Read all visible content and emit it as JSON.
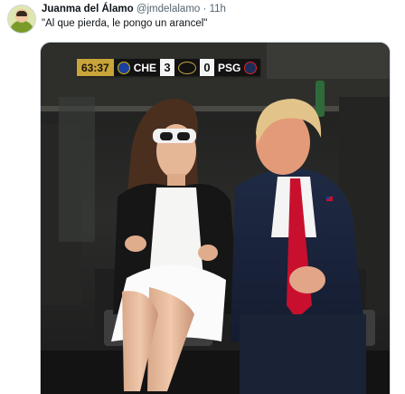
{
  "tweet": {
    "author_name": "Juanma del Álamo",
    "author_handle": "@jmdelalamo",
    "separator": "·",
    "time": "11h",
    "text": "\"Al que pierda, le pongo un arancel\""
  },
  "scoreboard": {
    "clock": "63:37",
    "home_team": "CHE",
    "home_score": "3",
    "away_score": "0",
    "away_team": "PSG"
  },
  "colors": {
    "clock_bg": "#c9a43a",
    "bug_bg": "#121212",
    "tie_red": "#c8102e"
  }
}
